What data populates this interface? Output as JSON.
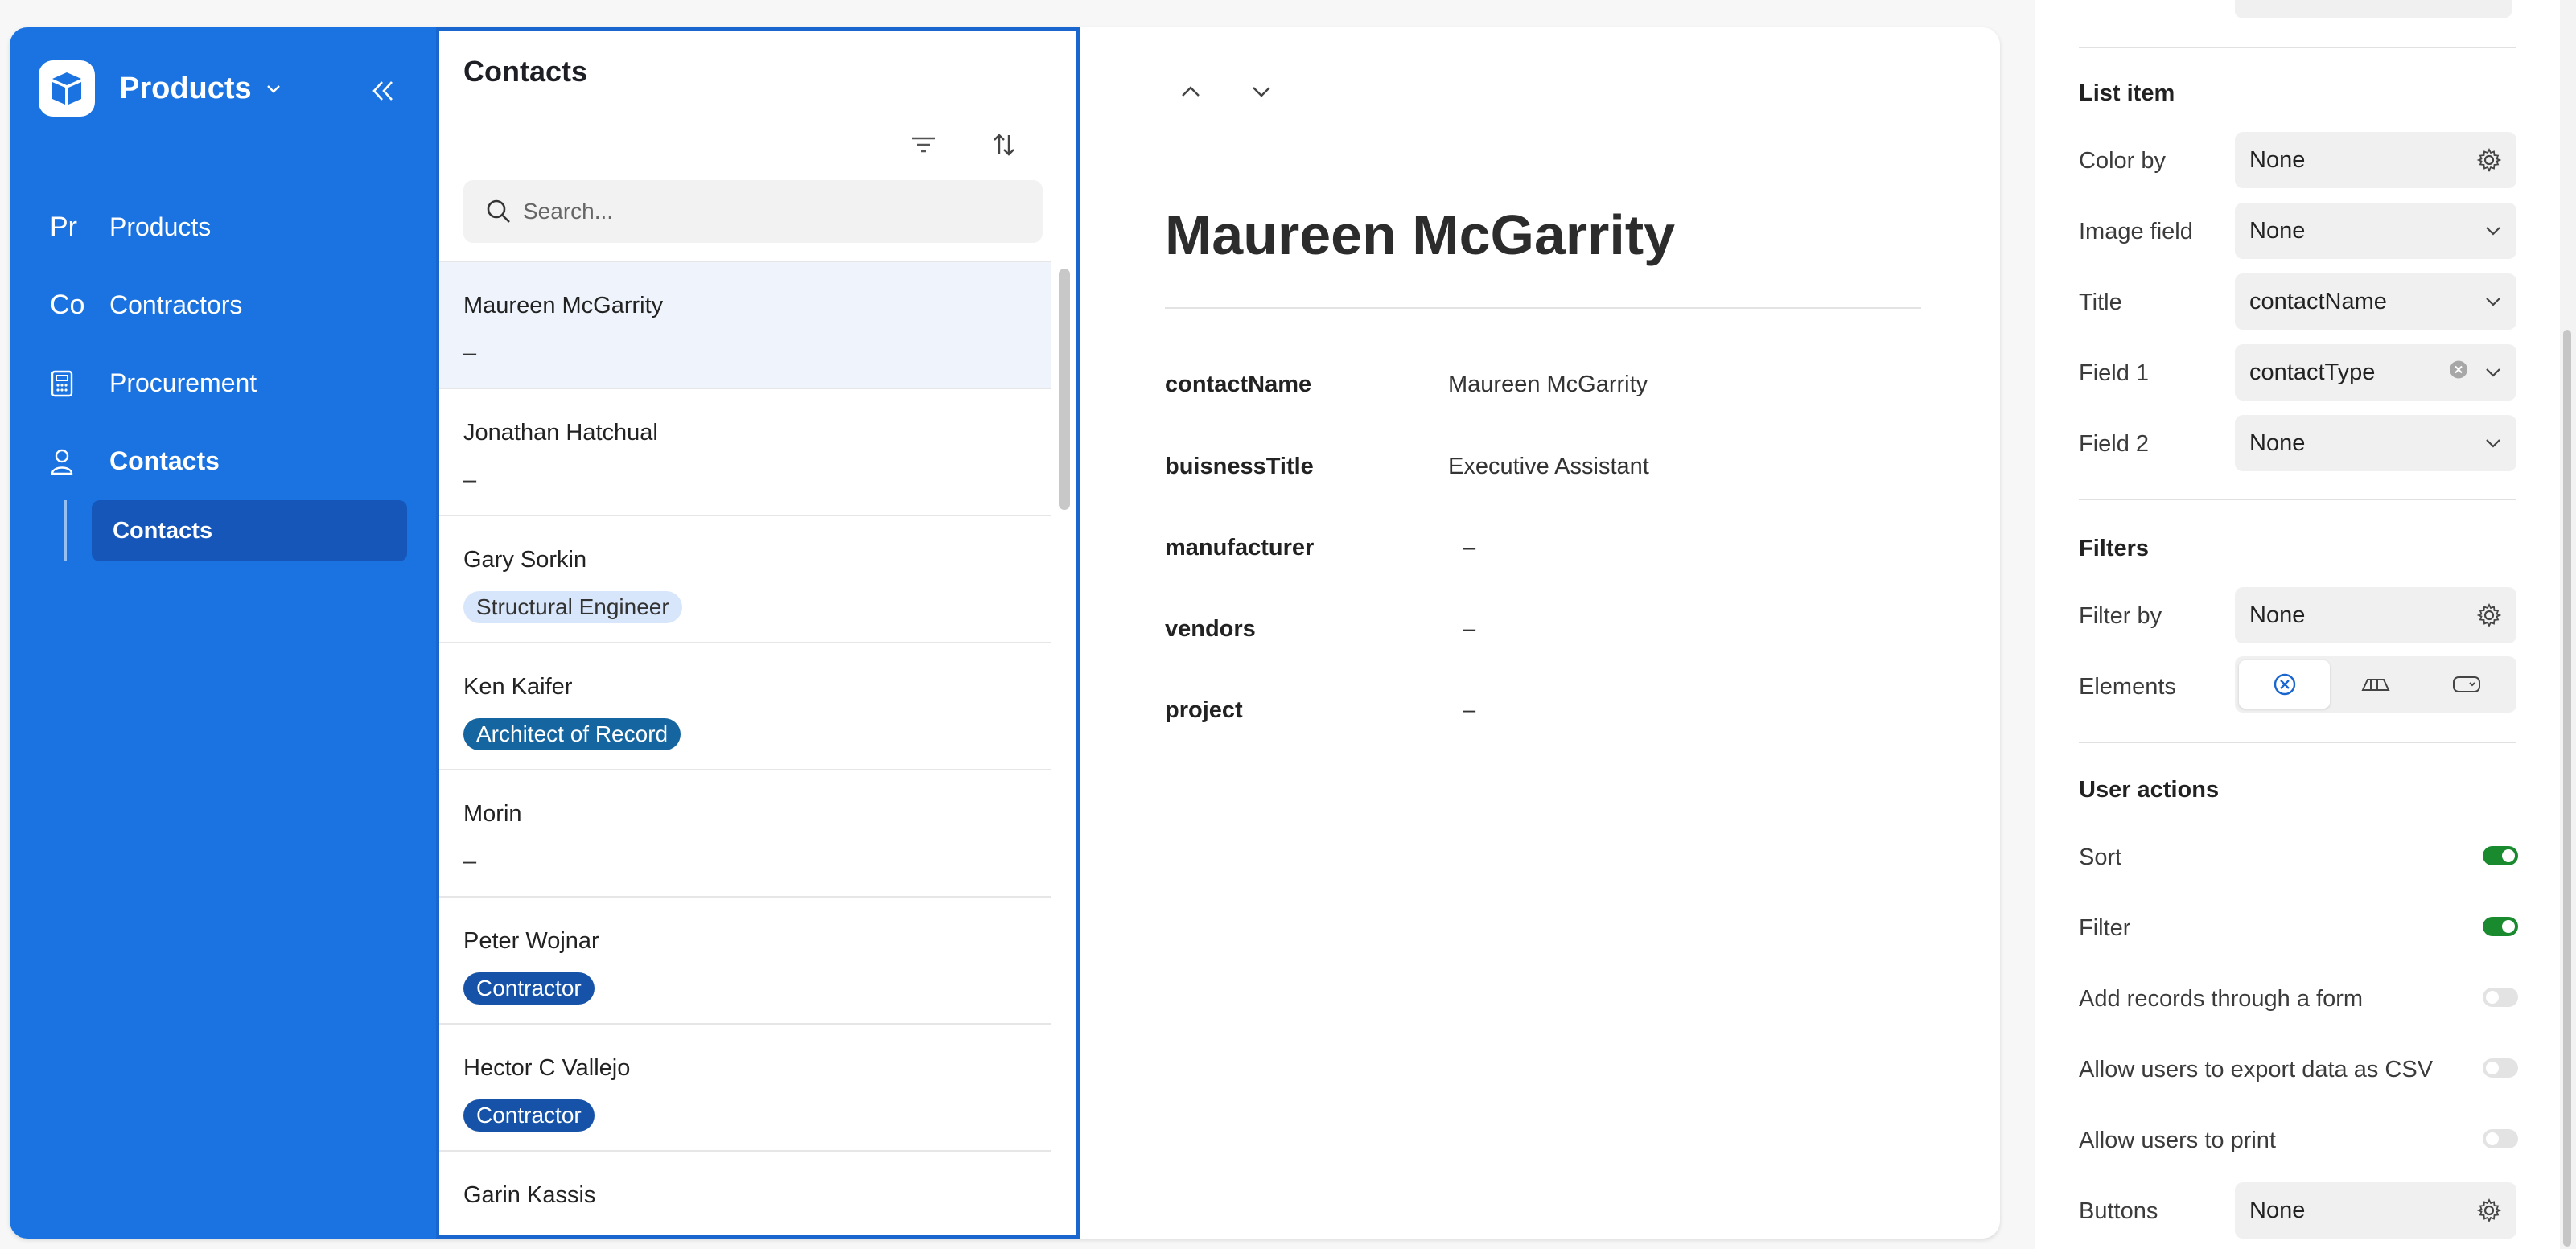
{
  "sidebar": {
    "brand": "Products",
    "items": [
      {
        "abbr": "Pr",
        "label": "Products"
      },
      {
        "abbr": "Co",
        "label": "Contractors"
      },
      {
        "label": "Procurement"
      },
      {
        "label": "Contacts"
      }
    ],
    "sub_item": "Contacts"
  },
  "list": {
    "title": "Contacts",
    "search_placeholder": "Search...",
    "rows": [
      {
        "name": "Maureen McGarrity",
        "sub": "–"
      },
      {
        "name": "Jonathan Hatchual",
        "sub": "–"
      },
      {
        "name": "Gary Sorkin",
        "badge": "Structural Engineer"
      },
      {
        "name": "Ken Kaifer",
        "badge": "Architect of Record"
      },
      {
        "name": "Morin",
        "sub": "–"
      },
      {
        "name": "Peter Wojnar",
        "badge": "Contractor"
      },
      {
        "name": "Hector C Vallejo",
        "badge": "Contractor"
      },
      {
        "name": "Garin Kassis",
        "sub": ""
      }
    ]
  },
  "detail": {
    "title": "Maureen McGarrity",
    "fields": [
      {
        "name": "contactName",
        "value": "Maureen McGarrity"
      },
      {
        "name": "buisnessTitle",
        "value": "Executive Assistant"
      },
      {
        "name": "manufacturer",
        "value": "–"
      },
      {
        "name": "vendors",
        "value": "–"
      },
      {
        "name": "project",
        "value": "–"
      }
    ]
  },
  "config": {
    "list_item": {
      "title": "List item",
      "color_by": {
        "label": "Color by",
        "value": "None"
      },
      "image_field": {
        "label": "Image field",
        "value": "None"
      },
      "title_field": {
        "label": "Title",
        "value": "contactName"
      },
      "field1": {
        "label": "Field 1",
        "value": "contactType"
      },
      "field2": {
        "label": "Field 2",
        "value": "None"
      }
    },
    "filters": {
      "title": "Filters",
      "filter_by": {
        "label": "Filter by",
        "value": "None"
      },
      "elements": {
        "label": "Elements"
      }
    },
    "user_actions": {
      "title": "User actions",
      "sort": {
        "label": "Sort",
        "on": true
      },
      "filter": {
        "label": "Filter",
        "on": true
      },
      "add_records": {
        "label": "Add records through a form",
        "on": false
      },
      "export_csv": {
        "label": "Allow users to export data as CSV",
        "on": false
      },
      "print": {
        "label": "Allow users to print",
        "on": false
      },
      "buttons": {
        "label": "Buttons",
        "value": "None"
      }
    }
  },
  "colors": {
    "sidebar": "#1a73e0",
    "accent": "#1a66cf",
    "toggle_on": "#1a8a2e"
  }
}
